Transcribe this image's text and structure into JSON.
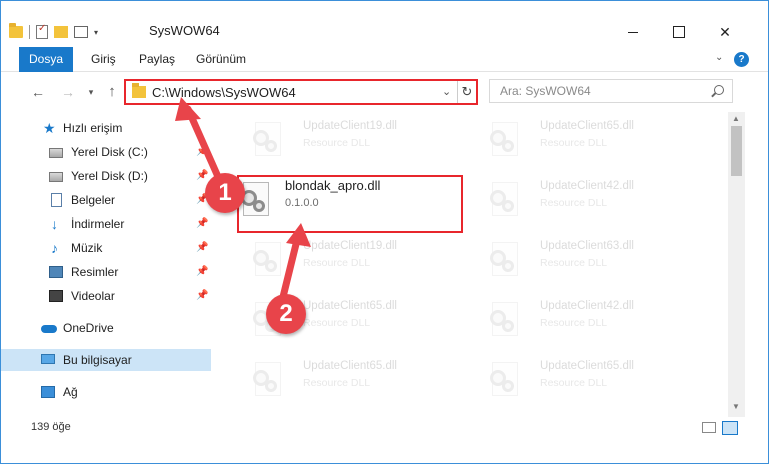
{
  "window": {
    "title": "SysWOW64",
    "accent_color": "#1979ca",
    "highlight_color": "#e8262c"
  },
  "ribbon": {
    "tabs": [
      {
        "label": "Dosya"
      },
      {
        "label": "Giriş"
      },
      {
        "label": "Paylaş"
      },
      {
        "label": "Görünüm"
      }
    ]
  },
  "address": {
    "path": "C:\\Windows\\SysWOW64"
  },
  "search": {
    "placeholder": "Ara: SysWOW64"
  },
  "sidebar": {
    "items": [
      {
        "label": "Hızlı erişim",
        "icon": "star-icon"
      },
      {
        "label": "Yerel Disk (C:)",
        "icon": "disk-icon",
        "pinned": true
      },
      {
        "label": "Yerel Disk (D:)",
        "icon": "disk-icon",
        "pinned": true
      },
      {
        "label": "Belgeler",
        "icon": "documents-icon",
        "pinned": true
      },
      {
        "label": "İndirmeler",
        "icon": "download-icon",
        "pinned": true
      },
      {
        "label": "Müzik",
        "icon": "music-icon",
        "pinned": true
      },
      {
        "label": "Resimler",
        "icon": "pictures-icon",
        "pinned": true
      },
      {
        "label": "Videolar",
        "icon": "videos-icon",
        "pinned": true
      },
      {
        "label": "OneDrive",
        "icon": "cloud-icon"
      },
      {
        "label": "Bu bilgisayar",
        "icon": "computer-icon",
        "selected": true
      },
      {
        "label": "Ağ",
        "icon": "network-icon"
      }
    ]
  },
  "files": [
    {
      "name": "UpdateClient19.dll",
      "desc": "Resource DLL",
      "faded": true
    },
    {
      "name": "UpdateClient65.dll",
      "desc": "Resource DLL",
      "faded": true
    },
    {
      "name": "blondak_apro.dll",
      "desc": "0.1.0.0",
      "faded": false
    },
    {
      "name": "UpdateClient42.dll",
      "desc": "Resource DLL",
      "faded": true
    },
    {
      "name": "UpdateClient19.dll",
      "desc": "Resource DLL",
      "faded": true
    },
    {
      "name": "UpdateClient63.dll",
      "desc": "Resource DLL",
      "faded": true
    },
    {
      "name": "UpdateClient65.dll",
      "desc": "Resource DLL",
      "faded": true
    },
    {
      "name": "UpdateClient42.dll",
      "desc": "Resource DLL",
      "faded": true
    },
    {
      "name": "UpdateClient65.dll",
      "desc": "Resource DLL",
      "faded": true
    },
    {
      "name": "UpdateClient65.dll",
      "desc": "Resource DLL",
      "faded": true
    }
  ],
  "status": {
    "item_count": "139 öğe"
  },
  "annotations": {
    "callout_1": "1",
    "callout_2": "2"
  }
}
